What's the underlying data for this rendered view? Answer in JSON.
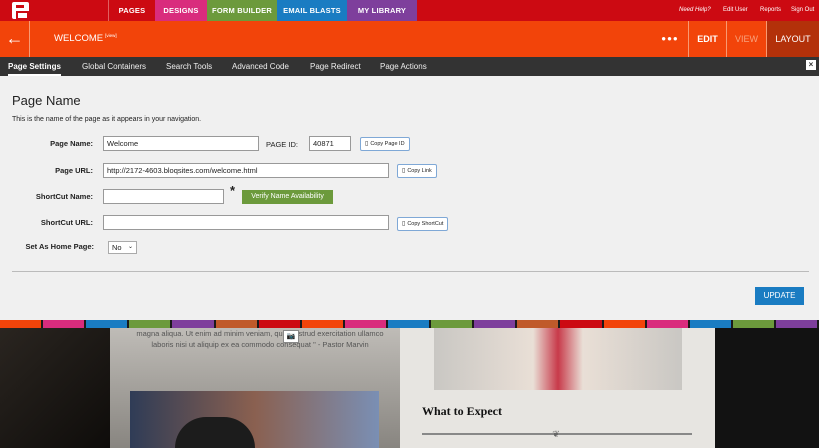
{
  "topnav": {
    "tabs": [
      {
        "label": "PAGES",
        "color": "#cc0a12"
      },
      {
        "label": "DESIGNS",
        "color": "#d92c7d"
      },
      {
        "label": "FORM BUILDER",
        "color": "#6c9a3c"
      },
      {
        "label": "EMAIL BLASTS",
        "color": "#1a7cc2"
      },
      {
        "label": "MY LIBRARY",
        "color": "#7e3f9c"
      }
    ],
    "links": [
      "Need Help?",
      "Edit User",
      "Reports",
      "Sign Out"
    ]
  },
  "header": {
    "page_title": "WELCOME",
    "view_tag": "[view]",
    "edit_label": "EDIT",
    "view_label": "VIEW",
    "layout_label": "LAYOUT"
  },
  "subnav": {
    "items": [
      "Page Settings",
      "Global Containers",
      "Search Tools",
      "Advanced Code",
      "Page Redirect",
      "Page Actions"
    ]
  },
  "form": {
    "heading": "Page Name",
    "description": "This is the name of the page as it appears in your navigation.",
    "page_name_label": "Page Name:",
    "page_name_value": "Welcome",
    "page_id_label": "PAGE ID:",
    "page_id_value": "40871",
    "copy_page_id": "Copy Page ID",
    "page_url_label": "Page URL:",
    "page_url_value": "http://2172-4603.bloqsites.com/welcome.html",
    "copy_link": "Copy Link",
    "shortcut_name_label": "ShortCut Name:",
    "shortcut_name_value": "",
    "required_mark": "*",
    "verify_label": "Verify Name Availability",
    "shortcut_url_label": "ShortCut URL:",
    "shortcut_url_value": "",
    "copy_shortcut": "Copy ShortCut",
    "home_page_label": "Set As Home Page:",
    "home_page_value": "No",
    "update_label": "UPDATE"
  },
  "preview": {
    "quote": "magna aliqua. Ut enim ad minim veniam, quis nostrud exercitation ullamco laboris nisi ut aliquip ex ea commodo consequat \" - Pastor Marvin",
    "section_heading": "What to Expect"
  },
  "stripe_colors": [
    "#f2440a",
    "#d92c7d",
    "#1a7cc2",
    "#6c9a3c",
    "#7e3f9c",
    "#c05a2a",
    "#cc0a12",
    "#f2440a",
    "#d92c7d",
    "#1a7cc2",
    "#6c9a3c",
    "#7e3f9c",
    "#c05a2a",
    "#cc0a12",
    "#f2440a",
    "#d92c7d",
    "#1a7cc2",
    "#6c9a3c",
    "#7e3f9c"
  ]
}
